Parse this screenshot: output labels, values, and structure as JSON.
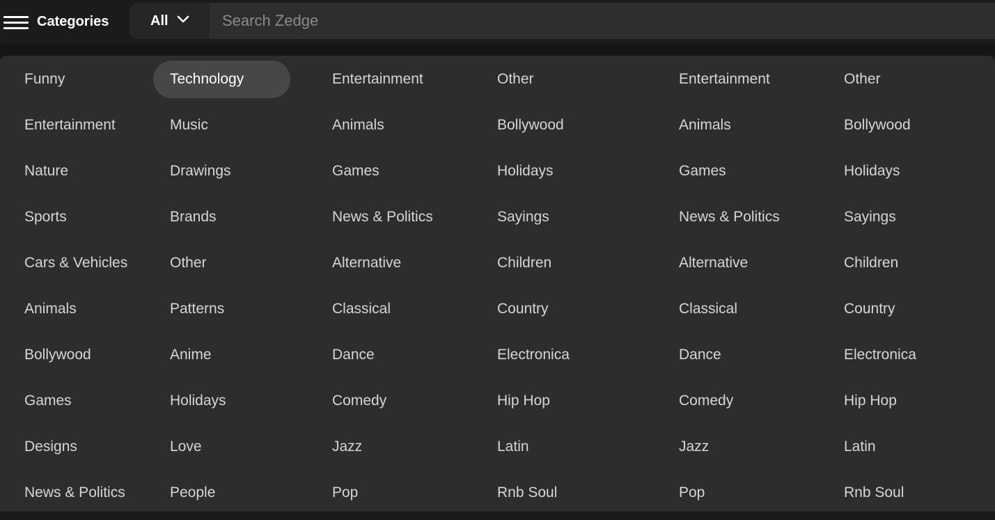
{
  "header": {
    "menu_label": "Categories",
    "filter_label": "All",
    "search_placeholder": "Search Zedge"
  },
  "categories": {
    "columns": [
      [
        "Funny",
        "Entertainment",
        "Nature",
        "Sports",
        "Cars & Vehicles",
        "Animals",
        "Bollywood",
        "Games",
        "Designs",
        "News & Politics"
      ],
      [
        "Technology",
        "Music",
        "Drawings",
        "Brands",
        "Other",
        "Patterns",
        "Anime",
        "Holidays",
        "Love",
        "People"
      ],
      [
        "Entertainment",
        "Animals",
        "Games",
        "News & Politics",
        "Alternative",
        "Classical",
        "Dance",
        "Comedy",
        "Jazz",
        "Pop"
      ],
      [
        "Other",
        "Bollywood",
        "Holidays",
        "Sayings",
        "Children",
        "Country",
        "Electronica",
        "Hip Hop",
        "Latin",
        "Rnb Soul"
      ],
      [
        "Entertainment",
        "Animals",
        "Games",
        "News & Politics",
        "Alternative",
        "Classical",
        "Dance",
        "Comedy",
        "Jazz",
        "Pop"
      ],
      [
        "Other",
        "Bollywood",
        "Holidays",
        "Sayings",
        "Children",
        "Country",
        "Electronica",
        "Hip Hop",
        "Latin",
        "Rnb Soul"
      ]
    ],
    "active": "Technology"
  },
  "colors": {
    "background": "#1a1a1a",
    "panel": "#2d2d2d",
    "active_item": "#474747",
    "text": "#d6d6d6"
  },
  "icons": {
    "menu": "hamburger-menu-icon",
    "dropdown": "chevron-down-icon"
  }
}
